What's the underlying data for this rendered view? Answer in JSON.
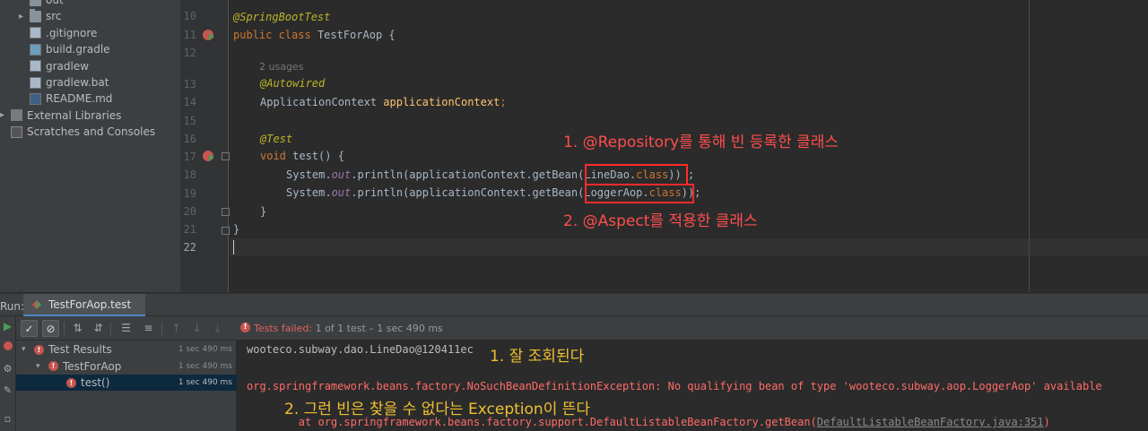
{
  "project_tree": [
    {
      "label": "out",
      "icon": "folder-icon",
      "indent": 33,
      "chevron": false
    },
    {
      "label": "src",
      "icon": "folder-icon",
      "indent": 33,
      "chevron": true
    },
    {
      "label": ".gitignore",
      "icon": "file-icon",
      "indent": 33,
      "chevron": false
    },
    {
      "label": "build.gradle",
      "icon": "gradle-file-icon",
      "indent": 33,
      "chevron": false
    },
    {
      "label": "gradlew",
      "icon": "file-icon",
      "indent": 33,
      "chevron": false
    },
    {
      "label": "gradlew.bat",
      "icon": "file-icon",
      "indent": 33,
      "chevron": false
    },
    {
      "label": "README.md",
      "icon": "markdown-file-icon",
      "indent": 33,
      "chevron": false
    },
    {
      "label": "External Libraries",
      "icon": "library-icon",
      "indent": 12,
      "chevron": true
    },
    {
      "label": "Scratches and Consoles",
      "icon": "scratches-icon",
      "indent": 12,
      "chevron": false
    }
  ],
  "code": {
    "line_numbers": [
      "10",
      "11",
      "12",
      "13",
      "14",
      "15",
      "16",
      "17",
      "18",
      "19",
      "20",
      "21",
      "22"
    ],
    "usages_hint": "2 usages",
    "line10": "@SpringBootTest",
    "line11_kw": "public class",
    "line11_name": "TestForAop",
    "line11_brace": " {",
    "line13": "@Autowired",
    "line14_type": "ApplicationContext",
    "line14_field": "applicationContext",
    "line14_end": ";",
    "line16": "@Test",
    "line17_kw": "void",
    "line17_rest": " test() {",
    "line18_a": "System.",
    "line18_out": "out",
    "line18_b": ".println(applicationContext.getBean(LineDao.",
    "line18_cls": "class",
    "line18_c": ")) ;",
    "line19_a": "System.",
    "line19_out": "out",
    "line19_b": ".println(applicationContext.getBean(LoggerAop.",
    "line19_cls": "class",
    "line19_c": "));",
    "line20": "}",
    "line21": "}"
  },
  "annotations": {
    "note1": "1. @Repository를 통해 빈 등록한 클래스",
    "note2": "2. @Aspect를 적용한 클래스",
    "console_note1": "1. 잘 조회된다",
    "console_note2": "2. 그런 빈은 찾을 수 없다는 Exception이 뜬다"
  },
  "run_panel": {
    "label": "Run:",
    "tab": "TestForAop.test",
    "status_prefix": "Tests failed:",
    "status_rest": "1 of 1 test – 1 sec 490 ms",
    "tree": [
      {
        "label": "Test Results",
        "duration": "1 sec 490 ms",
        "indent": 6,
        "chevron": "▾",
        "selected": false
      },
      {
        "label": "TestForAop",
        "duration": "1 sec 490 ms",
        "indent": 22,
        "chevron": "▾",
        "selected": false
      },
      {
        "label": "test()",
        "duration": "1 sec 490 ms",
        "indent": 56,
        "chevron": "",
        "selected": true
      }
    ]
  },
  "console": {
    "line1": "wooteco.subway.dao.LineDao@120411ec",
    "line2": "org.springframework.beans.factory.NoSuchBeanDefinitionException: No qualifying bean of type 'wooteco.subway.aop.LoggerAop' available",
    "line3_prefix": "\tat org.springframework.beans.factory.support.DefaultListableBeanFactory.getBean(",
    "line3_link": "DefaultListableBeanFactory.java:351",
    "line3_suffix": ")"
  },
  "colors": {
    "annotation_red": "#ff4d4d",
    "annotation_yellow": "#f0c030",
    "error_text": "#ff6b68",
    "keyword": "#cc7832"
  }
}
